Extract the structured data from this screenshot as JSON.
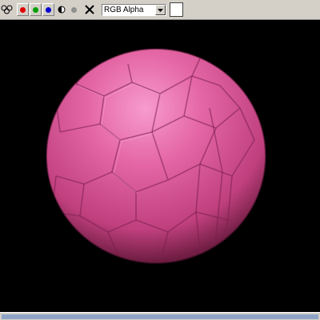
{
  "toolbar": {
    "channel_select": {
      "value": "RGB Alpha"
    },
    "buttons": [
      {
        "name": "clone-icon"
      },
      {
        "name": "red-channel-icon",
        "color": "#e00000"
      },
      {
        "name": "green-channel-icon",
        "color": "#00a000"
      },
      {
        "name": "blue-channel-icon",
        "color": "#0000d0"
      },
      {
        "name": "monochrome-icon"
      },
      {
        "name": "alpha-icon",
        "color": "#909090"
      },
      {
        "name": "clear-icon"
      }
    ],
    "swatch_color": "#ffffff"
  },
  "render": {
    "background_color": "#000000",
    "sphere_color": "#e05a9a"
  }
}
